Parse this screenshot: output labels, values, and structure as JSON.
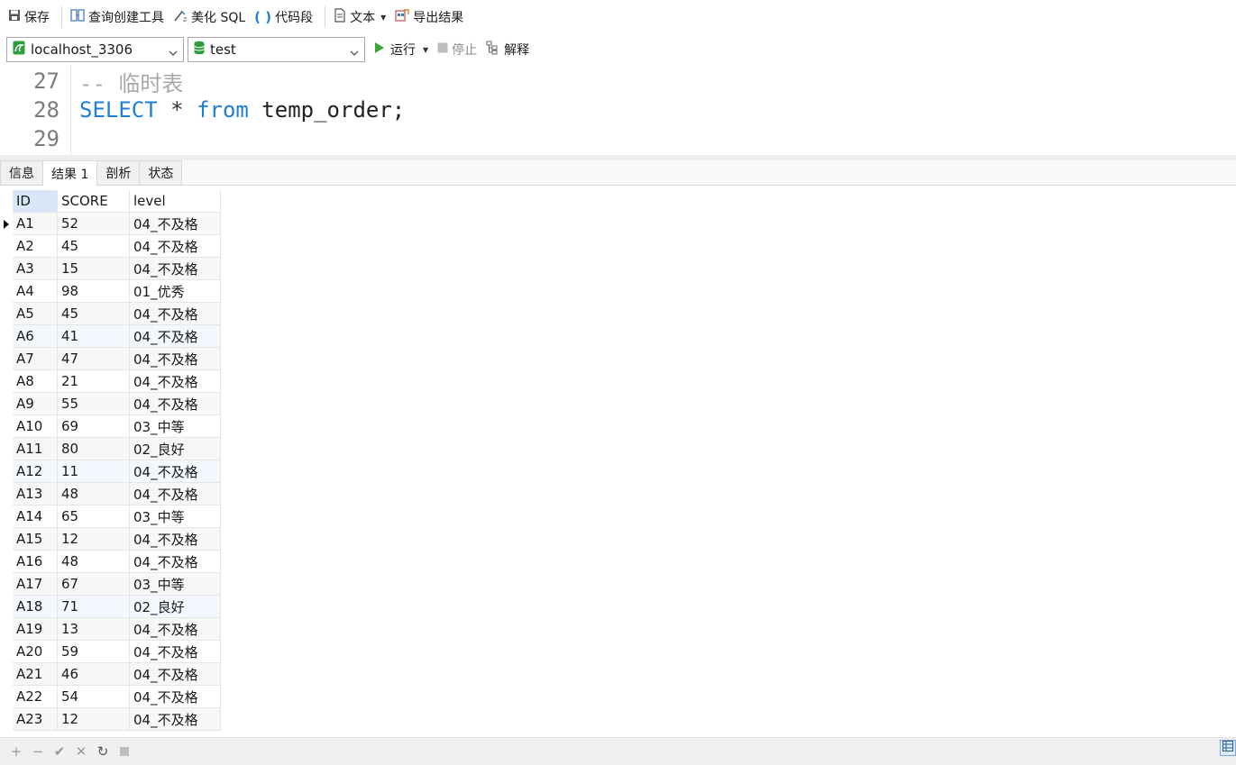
{
  "toolbar": {
    "save_label": "保存",
    "query_builder_label": "查询创建工具",
    "beautify_label": "美化 SQL",
    "snippet_label": "代码段",
    "text_label": "文本",
    "export_label": "导出结果"
  },
  "connection": {
    "selected": "localhost_3306"
  },
  "database": {
    "selected": "test"
  },
  "actions": {
    "run_label": "运行",
    "stop_label": "停止",
    "explain_label": "解释"
  },
  "editor": {
    "lines": [
      {
        "num": "27",
        "comment": "-- 临时表"
      },
      {
        "num": "28",
        "kw1": "SELECT",
        "op": " * ",
        "kw2": "from",
        "rest": " temp_order;"
      },
      {
        "num": "29"
      }
    ]
  },
  "tabs": [
    {
      "label": "信息"
    },
    {
      "label": "结果 1"
    },
    {
      "label": "剖析"
    },
    {
      "label": "状态"
    }
  ],
  "grid": {
    "columns": [
      "ID",
      "SCORE",
      "level"
    ],
    "rows": [
      [
        "A1",
        "52",
        "04_不及格"
      ],
      [
        "A2",
        "45",
        "04_不及格"
      ],
      [
        "A3",
        "15",
        "04_不及格"
      ],
      [
        "A4",
        "98",
        "01_优秀"
      ],
      [
        "A5",
        "45",
        "04_不及格"
      ],
      [
        "A6",
        "41",
        "04_不及格"
      ],
      [
        "A7",
        "47",
        "04_不及格"
      ],
      [
        "A8",
        "21",
        "04_不及格"
      ],
      [
        "A9",
        "55",
        "04_不及格"
      ],
      [
        "A10",
        "69",
        "03_中等"
      ],
      [
        "A11",
        "80",
        "02_良好"
      ],
      [
        "A12",
        "11",
        "04_不及格"
      ],
      [
        "A13",
        "48",
        "04_不及格"
      ],
      [
        "A14",
        "65",
        "03_中等"
      ],
      [
        "A15",
        "12",
        "04_不及格"
      ],
      [
        "A16",
        "48",
        "04_不及格"
      ],
      [
        "A17",
        "67",
        "03_中等"
      ],
      [
        "A18",
        "71",
        "02_良好"
      ],
      [
        "A19",
        "13",
        "04_不及格"
      ],
      [
        "A20",
        "59",
        "04_不及格"
      ],
      [
        "A21",
        "46",
        "04_不及格"
      ],
      [
        "A22",
        "54",
        "04_不及格"
      ],
      [
        "A23",
        "12",
        "04_不及格"
      ]
    ]
  },
  "colors": {
    "keyword": "#1e7fd6",
    "comment": "#a8a8a8",
    "run_green": "#3aa63a",
    "db_green": "#2e9e3a",
    "header_selected": "#d7e7f7"
  },
  "icons": {
    "save": "floppy-icon",
    "query_builder": "query-builder-icon",
    "beautify": "beautify-icon",
    "snippet": "braces-icon",
    "text": "document-icon",
    "export": "export-icon",
    "connection": "mysql-connection-icon",
    "database": "database-icon",
    "run": "play-icon",
    "stop": "stop-icon",
    "explain": "explain-icon"
  }
}
